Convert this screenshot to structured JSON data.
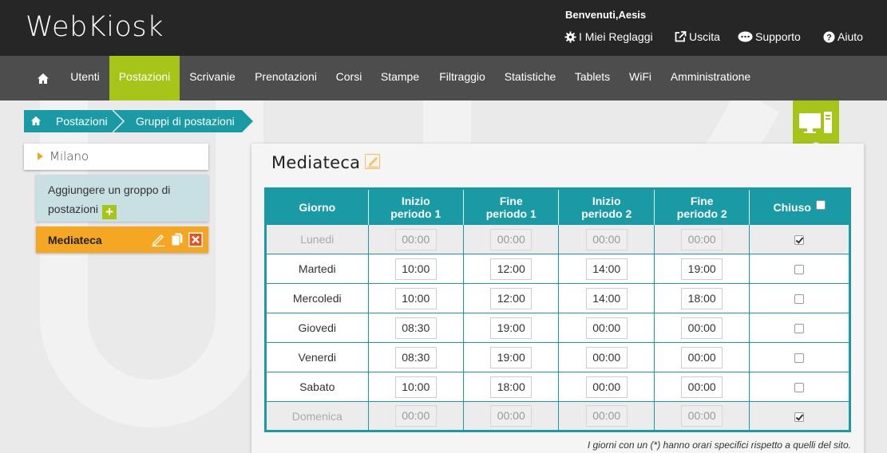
{
  "header": {
    "logo": "WebKiosk",
    "welcome": "Benvenuti,Aesis",
    "links": {
      "settings": "I Miei Reglaggi",
      "logout": "Uscita",
      "support": "Supporto",
      "help": "Aiuto"
    }
  },
  "nav": {
    "items": [
      "Utenti",
      "Postazioni",
      "Scrivanie",
      "Prenotazioni",
      "Corsi",
      "Stampe",
      "Filtraggio",
      "Statistiche",
      "Tablets",
      "WiFi",
      "Amministratione"
    ],
    "active": "Postazioni",
    "accent": "#a7c419"
  },
  "breadcrumb": {
    "items": [
      "Postazioni",
      "Gruppi di postazioni"
    ],
    "color": "#1a9aa5"
  },
  "sidebar": {
    "site": "Milano",
    "add_group_text": "Aggiungere un groppo di postazioni",
    "add_icon": "+",
    "group": "Mediateca",
    "group_color": "#f5a623"
  },
  "main": {
    "title": "Mediateca",
    "columns": [
      "Giorno",
      "Inizio periodo 1",
      "Fine periodo 1",
      "Inizio periodo 2",
      "Fine periodo 2",
      "Chiuso"
    ],
    "rows": [
      {
        "day": "Lunedi",
        "s1": "00:00",
        "e1": "00:00",
        "s2": "00:00",
        "e2": "00:00",
        "closed": true
      },
      {
        "day": "Martedi",
        "s1": "10:00",
        "e1": "12:00",
        "s2": "14:00",
        "e2": "19:00",
        "closed": false
      },
      {
        "day": "Mercoledi",
        "s1": "10:00",
        "e1": "12:00",
        "s2": "14:00",
        "e2": "18:00",
        "closed": false
      },
      {
        "day": "Giovedi",
        "s1": "08:30",
        "e1": "19:00",
        "s2": "00:00",
        "e2": "00:00",
        "closed": false
      },
      {
        "day": "Venerdi",
        "s1": "08:30",
        "e1": "19:00",
        "s2": "00:00",
        "e2": "00:00",
        "closed": false
      },
      {
        "day": "Sabato",
        "s1": "10:00",
        "e1": "18:00",
        "s2": "00:00",
        "e2": "00:00",
        "closed": false
      },
      {
        "day": "Domenica",
        "s1": "00:00",
        "e1": "00:00",
        "s2": "00:00",
        "e2": "00:00",
        "closed": true
      }
    ],
    "footnote": "I giorni con un (*) hanno orari specifici rispetto a quelli del sito."
  }
}
